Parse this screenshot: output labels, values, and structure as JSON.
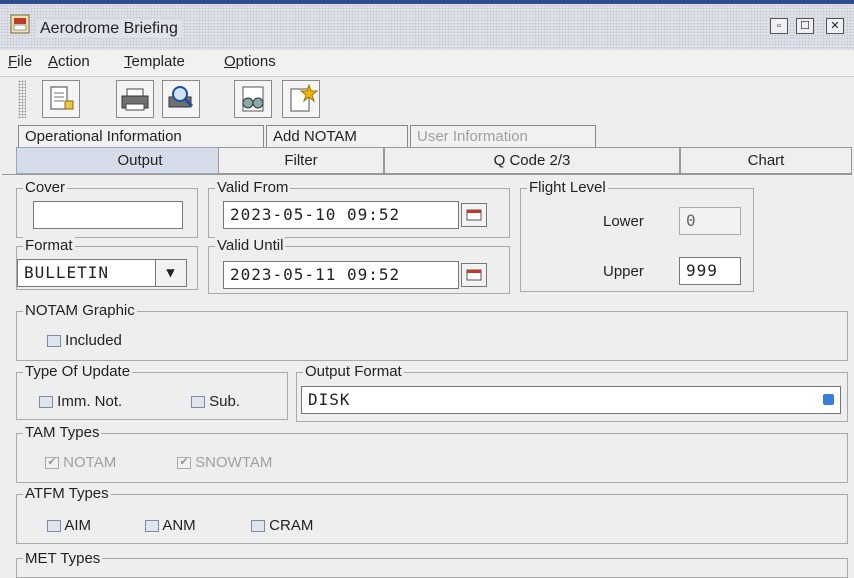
{
  "window": {
    "title": "Aerodrome Briefing",
    "minimize_glyph": "▫",
    "maximize_glyph": "☐",
    "close_glyph": "✕"
  },
  "menu": [
    {
      "mnemonic": "F",
      "rest": "ile"
    },
    {
      "mnemonic": "A",
      "rest": "ction"
    },
    {
      "mnemonic": "T",
      "rest": "emplate"
    },
    {
      "mnemonic": "O",
      "rest": "ptions"
    }
  ],
  "toolbar": [
    "new-document-icon",
    "print-icon",
    "print-preview-icon",
    "binoculars-icon",
    "wizard-icon"
  ],
  "tabs_row1": [
    "Operational Information",
    "Add NOTAM",
    "User Information"
  ],
  "tabs_row2": [
    "Output",
    "Filter",
    "Q Code 2/3",
    "Chart"
  ],
  "cover": {
    "label": "Cover",
    "value": ""
  },
  "format": {
    "label": "Format",
    "value": "BULLETIN"
  },
  "valid_from": {
    "label": "Valid From",
    "value": "2023-05-10 09:52"
  },
  "valid_until": {
    "label": "Valid Until",
    "value": "2023-05-11 09:52"
  },
  "flight_level": {
    "label": "Flight Level",
    "lower_label": "Lower",
    "lower_value": "0",
    "upper_label": "Upper",
    "upper_value": "999"
  },
  "notam_graphic": {
    "label": "NOTAM Graphic",
    "included_label": "Included",
    "included_checked": false
  },
  "type_of_update": {
    "label": "Type Of Update",
    "options": [
      {
        "label": "Imm. Not.",
        "checked": false
      },
      {
        "label": "Sub.",
        "checked": false
      }
    ]
  },
  "output_format": {
    "label": "Output Format",
    "value": "DISK"
  },
  "tam_types": {
    "label": "TAM Types",
    "options": [
      {
        "label": "NOTAM",
        "checked": true
      },
      {
        "label": "SNOWTAM",
        "checked": true
      }
    ]
  },
  "atfm_types": {
    "label": "ATFM Types",
    "options": [
      {
        "label": "AIM",
        "checked": false
      },
      {
        "label": "ANM",
        "checked": false
      },
      {
        "label": "CRAM",
        "checked": false
      }
    ]
  },
  "met_types": {
    "label": "MET Types"
  }
}
